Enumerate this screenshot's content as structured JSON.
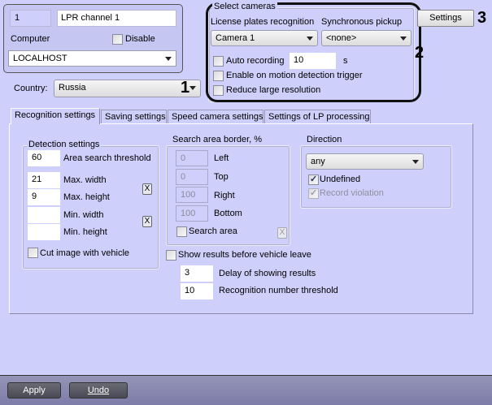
{
  "channel": {
    "id": "1",
    "name": "LPR channel 1",
    "computer_label": "Computer",
    "disable_label": "Disable",
    "disable_checked": false,
    "computer_value": "LOCALHOST"
  },
  "country": {
    "label": "Country:",
    "value": "Russia"
  },
  "cameras": {
    "group_label": "Select cameras",
    "lpr_label": "License plates recognition",
    "sync_label": "Synchronous pickup",
    "lpr_value": "Camera 1",
    "sync_value": "<none>",
    "auto_recording_label": "Auto recording",
    "auto_recording_value": "10",
    "seconds_unit": "s",
    "motion_label": "Enable on motion detection trigger",
    "reduce_label": "Reduce large resolution"
  },
  "settings_button": "Settings",
  "annotations": [
    "1",
    "2",
    "3"
  ],
  "tabs": [
    {
      "label": "Recognition settings",
      "selected": true
    },
    {
      "label": "Saving settings"
    },
    {
      "label": "Speed camera settings"
    },
    {
      "label": "Settings of LP processing"
    }
  ],
  "detection": {
    "label": "Detection settings",
    "area_threshold": "60",
    "area_threshold_label": "Area search threshold",
    "max_width": "21",
    "max_width_label": "Max. width",
    "max_height": "9",
    "max_height_label": "Max. height",
    "min_width": "",
    "min_width_label": "Min. width",
    "min_height": "",
    "min_height_label": "Min. height",
    "clear_label": "X",
    "cut_image_label": "Cut image with vehicle"
  },
  "search_area": {
    "label": "Search area border, %",
    "left": "0",
    "left_label": "Left",
    "top": "0",
    "top_label": "Top",
    "right": "100",
    "right_label": "Right",
    "bottom": "100",
    "bottom_label": "Bottom",
    "search_area_label": "Search area",
    "clear_label": "X"
  },
  "direction": {
    "label": "Direction",
    "value": "any",
    "undefined_label": "Undefined",
    "undefined_checked": true,
    "record_violation_label": "Record violation",
    "record_violation_checked": true
  },
  "results": {
    "show_before_leave_label": "Show results before vehicle leave",
    "delay": "3",
    "delay_label": "Delay of showing results",
    "threshold": "10",
    "threshold_label": "Recognition number threshold"
  },
  "footer": {
    "apply": "Apply",
    "undo": "Undo"
  },
  "colors": {
    "background": "#cfcffb",
    "footer": "#8585aa",
    "button": "#555560"
  }
}
